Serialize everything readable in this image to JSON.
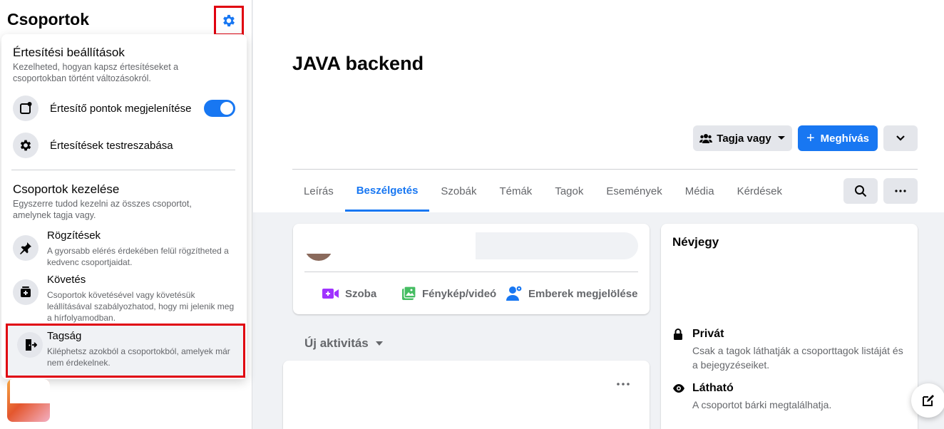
{
  "sidebar": {
    "title": "Csoportok",
    "notifications": {
      "heading": "Értesítési beállítások",
      "description": "Kezelheted, hogyan kapsz értesítéseket a csoportokban történt változásokról.",
      "show_dots_label": "Értesítő pontok megjelenítése",
      "show_dots_enabled": true,
      "customize_label": "Értesítések testreszabása"
    },
    "manage": {
      "heading": "Csoportok kezelése",
      "description": "Egyszerre tudod kezelni az összes csoportot, amelynek tagja vagy.",
      "items": [
        {
          "title": "Rögzítések",
          "desc": "A gyorsabb elérés érdekében felül rögzítheted a kedvenc csoportjaidat."
        },
        {
          "title": "Követés",
          "desc": "Csoportok követésével vagy követésük leállításával szabályozhatod, hogy mi jelenik meg a hírfolyamodban."
        },
        {
          "title": "Tagság",
          "desc": "Kiléphetsz azokból a csoportokból, amelyek már nem érdekelnek."
        }
      ]
    }
  },
  "group": {
    "title": "JAVA backend"
  },
  "actions": {
    "member_label": "Tagja vagy",
    "invite_label": "Meghívás"
  },
  "tabs": [
    "Leírás",
    "Beszélgetés",
    "Szobák",
    "Témák",
    "Tagok",
    "Események",
    "Média",
    "Kérdések"
  ],
  "active_tab": "Beszélgetés",
  "composer": {
    "room_label": "Szoba",
    "photo_label": "Fénykép/videó",
    "tag_label": "Emberek megjelölése"
  },
  "feed": {
    "activity_label": "Új aktivitás"
  },
  "about": {
    "title": "Névjegy",
    "private_title": "Privát",
    "private_desc": "Csak a tagok láthatják a csoporttagok listáját és a bejegyzéseiket.",
    "visible_title": "Látható",
    "visible_desc": "A csoportot bárki megtalálhatja."
  },
  "colors": {
    "accent": "#1877f2",
    "highlight_border": "#e0000f"
  }
}
